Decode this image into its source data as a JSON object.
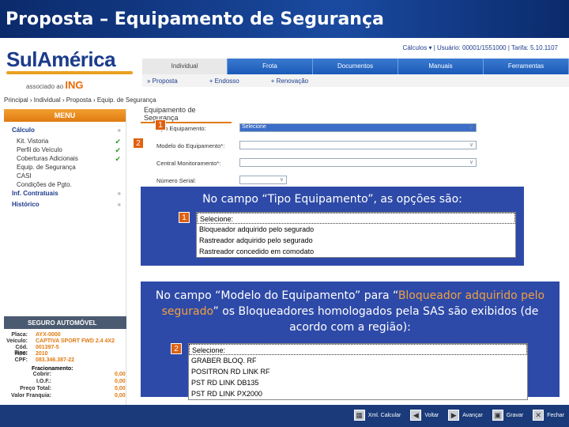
{
  "slide_title": "Proposta – Equipamento de Segurança",
  "brand": {
    "name": "SulAmérica",
    "assoc": "associado ao",
    "ing": "ING"
  },
  "topbar": {
    "text": "Cálculos ▾  |  Usuário: 00001/1551000  |  Tarifa: 5.10.1107"
  },
  "nav": [
    "Individual",
    "Frota",
    "Documentos",
    "Manuais",
    "Ferramentas"
  ],
  "subnav": [
    "» Proposta",
    "+ Endosso",
    "+ Renovação"
  ],
  "breadcrumb": "Principal › Individual › Proposta › Equip. de Segurança",
  "menu": {
    "title": "MENU",
    "items": [
      {
        "label": "Cálculo",
        "top": true,
        "mark": "arrow"
      },
      {
        "label": "Kit. Vistoria",
        "mark": "check"
      },
      {
        "label": "Perfil do Veículo",
        "mark": "check"
      },
      {
        "label": "Coberturas Adicionais",
        "mark": "check"
      },
      {
        "label": "Equip. de Segurança",
        "mark": ""
      },
      {
        "label": "CASI",
        "mark": ""
      },
      {
        "label": "Condições de Pgto.",
        "mark": ""
      },
      {
        "label": "Inf. Contratuais",
        "top": true,
        "mark": "arrow"
      },
      {
        "label": "Histórico",
        "top": true,
        "mark": "arrow"
      }
    ]
  },
  "seguro": {
    "title": "SEGURO AUTOMÓVEL",
    "rows": [
      {
        "k": "Placa:",
        "v": "AYX-0000"
      },
      {
        "k": "Veículo:",
        "v": "CAPTIVA SPORT FWD 2.4 4X2"
      },
      {
        "k": "Cód. Fipe:",
        "v": "001397-5"
      },
      {
        "k": "Ano:",
        "v": "2010"
      },
      {
        "k": "CPF:",
        "v": "083.346.387-22"
      }
    ],
    "fin_title": "Fracionamento:",
    "fin": [
      {
        "k": "Cobrir:",
        "v": "0,00"
      },
      {
        "k": "I.O.F.:",
        "v": "0,00"
      },
      {
        "k": "Preço Total:",
        "v": "0,00"
      },
      {
        "k": "Valor Franquia:",
        "v": "0,00"
      }
    ]
  },
  "form": {
    "title": "Equipamento de Segurança",
    "fields": [
      {
        "label": "Tipo Equipamento:",
        "value": "Selecione"
      },
      {
        "label": "Modelo do Equipamento*:",
        "value": ""
      },
      {
        "label": "Central Monitoramento*:",
        "value": ""
      },
      {
        "label": "Número Serial:",
        "value": ""
      }
    ]
  },
  "markers": {
    "one": "1",
    "two": "2"
  },
  "popup1": {
    "text": "No campo “Tipo Equipamento”, as opções são:",
    "options": [
      "Selecione:",
      "Bloqueador adquirido pelo segurado",
      "Rastreador adquirido pelo segurado",
      "Rastreador concedido em comodato"
    ]
  },
  "popup2": {
    "text_a": "No campo “Modelo do Equipamento” para “",
    "text_hl": "Bloqueador adquirido pelo segurado",
    "text_b": "” os Bloqueadores homologados pela SAS são exibidos (de acordo com a região):",
    "options": [
      "Selecione:",
      "GRABER BLOQ. RF",
      "POSITRON RD LINK RF",
      "PST RD LINK DB135",
      "PST RD LINK PX2000"
    ]
  },
  "bottom_buttons": [
    {
      "label": "Xml. Calcular",
      "icon": "calc-icon",
      "glyph": "▦"
    },
    {
      "label": "Voltar",
      "icon": "back-icon",
      "glyph": "◀"
    },
    {
      "label": "Avançar",
      "icon": "forward-icon",
      "glyph": "▶"
    },
    {
      "label": "Gravar",
      "icon": "save-icon",
      "glyph": "▣"
    },
    {
      "label": "Fechar",
      "icon": "close-icon",
      "glyph": "✕"
    }
  ]
}
